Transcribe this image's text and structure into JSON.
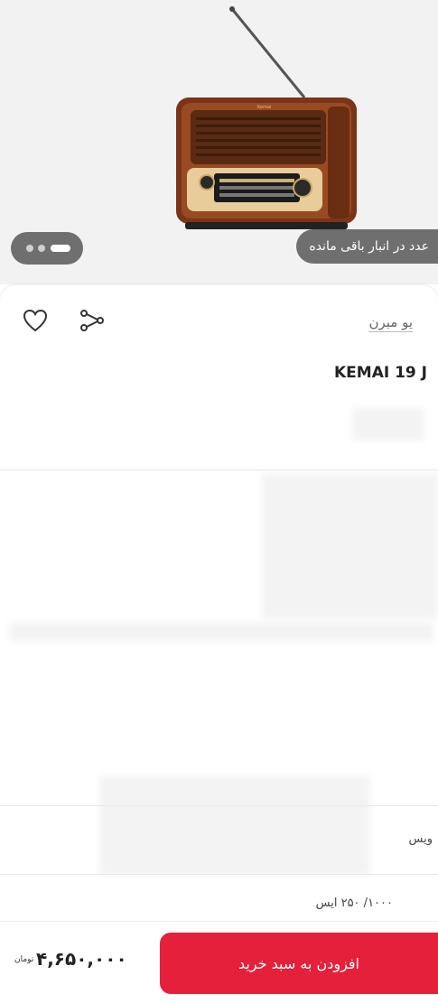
{
  "product": {
    "stock_text": "عدد در انبار باقی مانده",
    "brand_link": "یو مبرن",
    "title": "KEMAI 19 J",
    "fragment_row1": "ویس",
    "fragment_row2": "۱۰۰۰/ ۲۵۰ ایس"
  },
  "gallery": {
    "image_icon": "vintage-wooden-radio-image",
    "slide_count": 3,
    "active_index": 0
  },
  "actions": {
    "favorite_icon": "heart-icon",
    "share_icon": "share-icon"
  },
  "purchase": {
    "add_to_cart_label": "افزودن به سبد خرید",
    "price": "۴,۶۵۰,۰۰۰",
    "currency": "تومان"
  },
  "colors": {
    "accent": "#e5203b",
    "pill_background": "#6f6f6f",
    "hero_background": "#f2f2f2"
  }
}
